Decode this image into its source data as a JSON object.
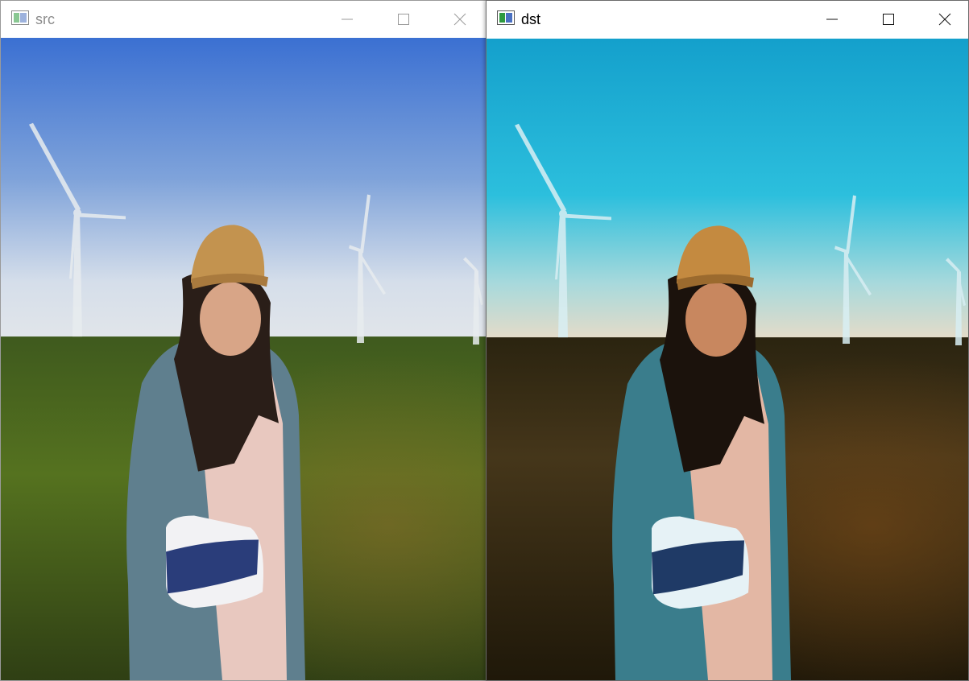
{
  "windows": [
    {
      "id": "src",
      "title": "src",
      "active": false,
      "controls": [
        "minimize-icon",
        "maximize-icon",
        "close-icon"
      ],
      "content": "image"
    },
    {
      "id": "dst",
      "title": "dst",
      "active": true,
      "controls": [
        "minimize-icon",
        "maximize-icon",
        "close-icon"
      ],
      "content": "image"
    }
  ],
  "palette": {
    "src_sky_top": "#3f74d4",
    "src_sky_bottom": "#d9e3ee",
    "src_grass": "#4e6a22",
    "dst_sky_top": "#1aa6cf",
    "dst_sky_bottom": "#f1dcc6",
    "dst_grass": "#3a2c12"
  }
}
